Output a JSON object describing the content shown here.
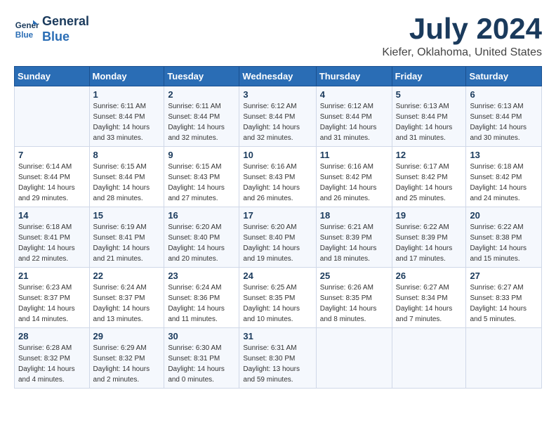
{
  "header": {
    "logo_line1": "General",
    "logo_line2": "Blue",
    "month_title": "July 2024",
    "location": "Kiefer, Oklahoma, United States"
  },
  "weekdays": [
    "Sunday",
    "Monday",
    "Tuesday",
    "Wednesday",
    "Thursday",
    "Friday",
    "Saturday"
  ],
  "weeks": [
    [
      {
        "day": "",
        "sunrise": "",
        "sunset": "",
        "daylight": ""
      },
      {
        "day": "1",
        "sunrise": "Sunrise: 6:11 AM",
        "sunset": "Sunset: 8:44 PM",
        "daylight": "Daylight: 14 hours and 33 minutes."
      },
      {
        "day": "2",
        "sunrise": "Sunrise: 6:11 AM",
        "sunset": "Sunset: 8:44 PM",
        "daylight": "Daylight: 14 hours and 32 minutes."
      },
      {
        "day": "3",
        "sunrise": "Sunrise: 6:12 AM",
        "sunset": "Sunset: 8:44 PM",
        "daylight": "Daylight: 14 hours and 32 minutes."
      },
      {
        "day": "4",
        "sunrise": "Sunrise: 6:12 AM",
        "sunset": "Sunset: 8:44 PM",
        "daylight": "Daylight: 14 hours and 31 minutes."
      },
      {
        "day": "5",
        "sunrise": "Sunrise: 6:13 AM",
        "sunset": "Sunset: 8:44 PM",
        "daylight": "Daylight: 14 hours and 31 minutes."
      },
      {
        "day": "6",
        "sunrise": "Sunrise: 6:13 AM",
        "sunset": "Sunset: 8:44 PM",
        "daylight": "Daylight: 14 hours and 30 minutes."
      }
    ],
    [
      {
        "day": "7",
        "sunrise": "Sunrise: 6:14 AM",
        "sunset": "Sunset: 8:44 PM",
        "daylight": "Daylight: 14 hours and 29 minutes."
      },
      {
        "day": "8",
        "sunrise": "Sunrise: 6:15 AM",
        "sunset": "Sunset: 8:44 PM",
        "daylight": "Daylight: 14 hours and 28 minutes."
      },
      {
        "day": "9",
        "sunrise": "Sunrise: 6:15 AM",
        "sunset": "Sunset: 8:43 PM",
        "daylight": "Daylight: 14 hours and 27 minutes."
      },
      {
        "day": "10",
        "sunrise": "Sunrise: 6:16 AM",
        "sunset": "Sunset: 8:43 PM",
        "daylight": "Daylight: 14 hours and 26 minutes."
      },
      {
        "day": "11",
        "sunrise": "Sunrise: 6:16 AM",
        "sunset": "Sunset: 8:42 PM",
        "daylight": "Daylight: 14 hours and 26 minutes."
      },
      {
        "day": "12",
        "sunrise": "Sunrise: 6:17 AM",
        "sunset": "Sunset: 8:42 PM",
        "daylight": "Daylight: 14 hours and 25 minutes."
      },
      {
        "day": "13",
        "sunrise": "Sunrise: 6:18 AM",
        "sunset": "Sunset: 8:42 PM",
        "daylight": "Daylight: 14 hours and 24 minutes."
      }
    ],
    [
      {
        "day": "14",
        "sunrise": "Sunrise: 6:18 AM",
        "sunset": "Sunset: 8:41 PM",
        "daylight": "Daylight: 14 hours and 22 minutes."
      },
      {
        "day": "15",
        "sunrise": "Sunrise: 6:19 AM",
        "sunset": "Sunset: 8:41 PM",
        "daylight": "Daylight: 14 hours and 21 minutes."
      },
      {
        "day": "16",
        "sunrise": "Sunrise: 6:20 AM",
        "sunset": "Sunset: 8:40 PM",
        "daylight": "Daylight: 14 hours and 20 minutes."
      },
      {
        "day": "17",
        "sunrise": "Sunrise: 6:20 AM",
        "sunset": "Sunset: 8:40 PM",
        "daylight": "Daylight: 14 hours and 19 minutes."
      },
      {
        "day": "18",
        "sunrise": "Sunrise: 6:21 AM",
        "sunset": "Sunset: 8:39 PM",
        "daylight": "Daylight: 14 hours and 18 minutes."
      },
      {
        "day": "19",
        "sunrise": "Sunrise: 6:22 AM",
        "sunset": "Sunset: 8:39 PM",
        "daylight": "Daylight: 14 hours and 17 minutes."
      },
      {
        "day": "20",
        "sunrise": "Sunrise: 6:22 AM",
        "sunset": "Sunset: 8:38 PM",
        "daylight": "Daylight: 14 hours and 15 minutes."
      }
    ],
    [
      {
        "day": "21",
        "sunrise": "Sunrise: 6:23 AM",
        "sunset": "Sunset: 8:37 PM",
        "daylight": "Daylight: 14 hours and 14 minutes."
      },
      {
        "day": "22",
        "sunrise": "Sunrise: 6:24 AM",
        "sunset": "Sunset: 8:37 PM",
        "daylight": "Daylight: 14 hours and 13 minutes."
      },
      {
        "day": "23",
        "sunrise": "Sunrise: 6:24 AM",
        "sunset": "Sunset: 8:36 PM",
        "daylight": "Daylight: 14 hours and 11 minutes."
      },
      {
        "day": "24",
        "sunrise": "Sunrise: 6:25 AM",
        "sunset": "Sunset: 8:35 PM",
        "daylight": "Daylight: 14 hours and 10 minutes."
      },
      {
        "day": "25",
        "sunrise": "Sunrise: 6:26 AM",
        "sunset": "Sunset: 8:35 PM",
        "daylight": "Daylight: 14 hours and 8 minutes."
      },
      {
        "day": "26",
        "sunrise": "Sunrise: 6:27 AM",
        "sunset": "Sunset: 8:34 PM",
        "daylight": "Daylight: 14 hours and 7 minutes."
      },
      {
        "day": "27",
        "sunrise": "Sunrise: 6:27 AM",
        "sunset": "Sunset: 8:33 PM",
        "daylight": "Daylight: 14 hours and 5 minutes."
      }
    ],
    [
      {
        "day": "28",
        "sunrise": "Sunrise: 6:28 AM",
        "sunset": "Sunset: 8:32 PM",
        "daylight": "Daylight: 14 hours and 4 minutes."
      },
      {
        "day": "29",
        "sunrise": "Sunrise: 6:29 AM",
        "sunset": "Sunset: 8:32 PM",
        "daylight": "Daylight: 14 hours and 2 minutes."
      },
      {
        "day": "30",
        "sunrise": "Sunrise: 6:30 AM",
        "sunset": "Sunset: 8:31 PM",
        "daylight": "Daylight: 14 hours and 0 minutes."
      },
      {
        "day": "31",
        "sunrise": "Sunrise: 6:31 AM",
        "sunset": "Sunset: 8:30 PM",
        "daylight": "Daylight: 13 hours and 59 minutes."
      },
      {
        "day": "",
        "sunrise": "",
        "sunset": "",
        "daylight": ""
      },
      {
        "day": "",
        "sunrise": "",
        "sunset": "",
        "daylight": ""
      },
      {
        "day": "",
        "sunrise": "",
        "sunset": "",
        "daylight": ""
      }
    ]
  ]
}
